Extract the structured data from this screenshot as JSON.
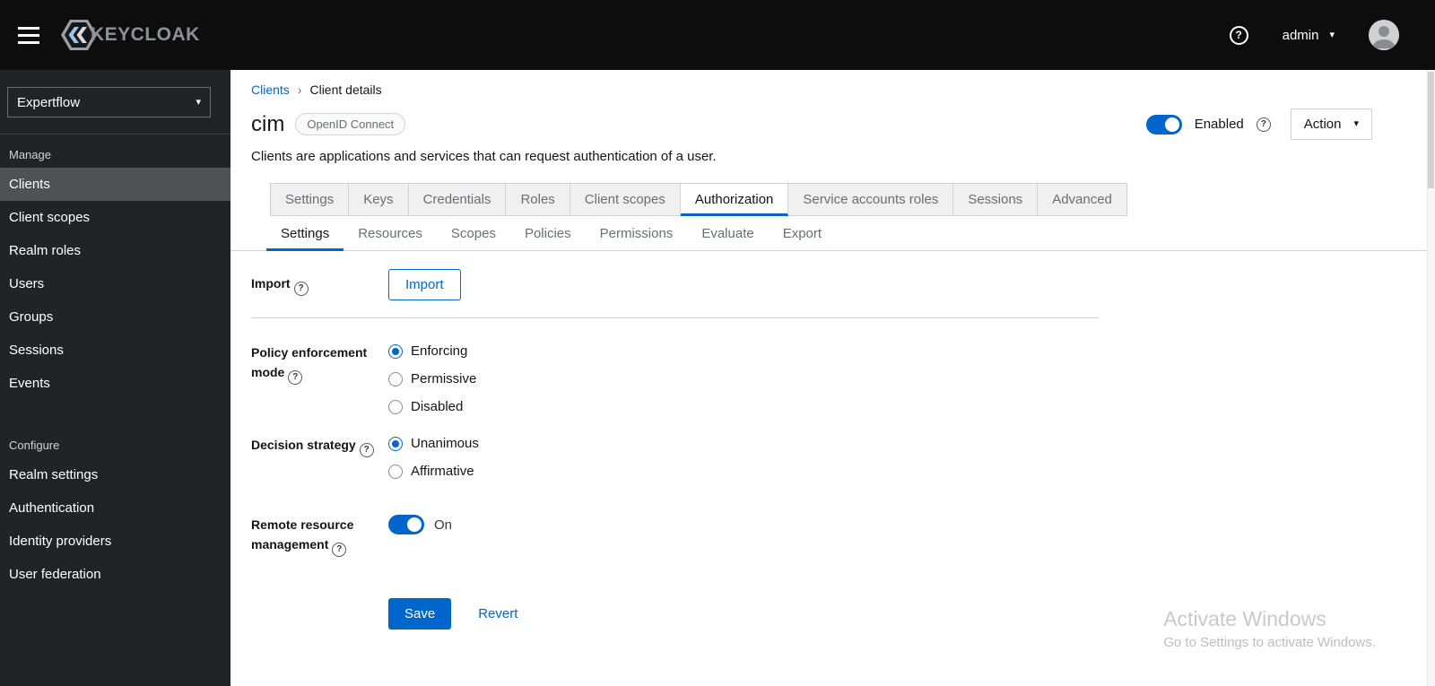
{
  "topbar": {
    "brand": "KEYCLOAK",
    "user": "admin"
  },
  "sidebar": {
    "realm": "Expertflow",
    "manage": {
      "label": "Manage",
      "items": [
        {
          "label": "Clients"
        },
        {
          "label": "Client scopes"
        },
        {
          "label": "Realm roles"
        },
        {
          "label": "Users"
        },
        {
          "label": "Groups"
        },
        {
          "label": "Sessions"
        },
        {
          "label": "Events"
        }
      ]
    },
    "configure": {
      "label": "Configure",
      "items": [
        {
          "label": "Realm settings"
        },
        {
          "label": "Authentication"
        },
        {
          "label": "Identity providers"
        },
        {
          "label": "User federation"
        }
      ]
    },
    "selected_item": "Clients"
  },
  "breadcrumb": {
    "items": [
      "Clients",
      "Client details"
    ]
  },
  "header": {
    "title": "cim",
    "badge": "OpenID Connect",
    "description": "Clients are applications and services that can request authentication of a user.",
    "enabled_label": "Enabled",
    "enabled_state": true,
    "action_label": "Action"
  },
  "tabs": {
    "items": [
      "Settings",
      "Keys",
      "Credentials",
      "Roles",
      "Client scopes",
      "Authorization",
      "Service accounts roles",
      "Sessions",
      "Advanced"
    ],
    "selected": "Authorization"
  },
  "subtabs": {
    "items": [
      "Settings",
      "Resources",
      "Scopes",
      "Policies",
      "Permissions",
      "Evaluate",
      "Export"
    ],
    "selected": "Settings"
  },
  "form": {
    "import": {
      "label": "Import",
      "button_label": "Import"
    },
    "policy_enforcement_mode": {
      "label": "Policy enforcement mode",
      "options": [
        "Enforcing",
        "Permissive",
        "Disabled"
      ],
      "selected": "Enforcing"
    },
    "decision_strategy": {
      "label": "Decision strategy",
      "options": [
        "Unanimous",
        "Affirmative"
      ],
      "selected": "Unanimous"
    },
    "remote_resource_management": {
      "label": "Remote resource management",
      "state_label": "On",
      "enabled": true
    },
    "save_label": "Save",
    "revert_label": "Revert"
  },
  "watermark": {
    "line1": "Activate Windows",
    "line2": "Go to Settings to activate Windows."
  },
  "icons": {
    "help": "?",
    "caret_down": "▾",
    "breadcrumb_separator": "›"
  },
  "colors": {
    "accent": "#0066cc",
    "topbar_bg": "#0d0d0d",
    "sidebar_bg": "#212427",
    "sidebar_selected_bg": "#4f5255",
    "tab_bg": "#f0f0f0",
    "border": "#d2d2d2",
    "muted_text": "#6a6e73"
  }
}
